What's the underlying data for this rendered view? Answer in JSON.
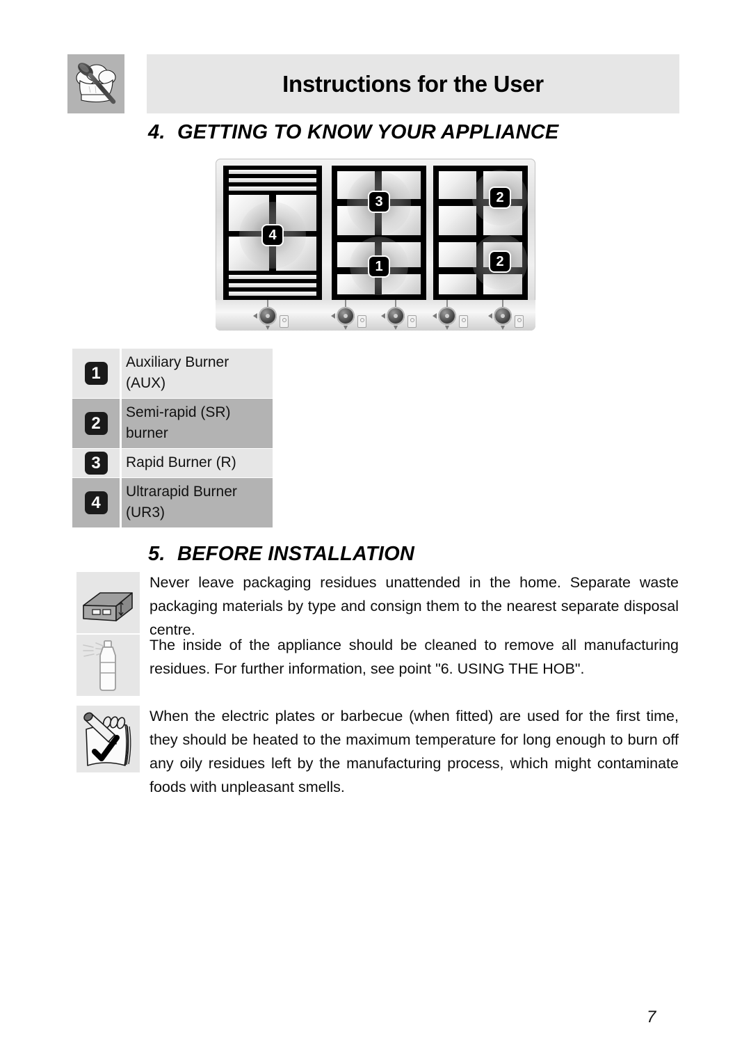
{
  "header": {
    "logo_icon": "chef-hat-spoon-icon",
    "title": "Instructions for the User"
  },
  "sections": [
    {
      "number": "4.",
      "title": "GETTING TO KNOW YOUR APPLIANCE"
    },
    {
      "number": "5.",
      "title": "BEFORE INSTALLATION"
    }
  ],
  "hob": {
    "alt": "Five-burner gas hob with three grate panels and five control knobs",
    "burner_markers": [
      {
        "label": "4",
        "panel": "left",
        "position": "centre"
      },
      {
        "label": "3",
        "panel": "middle",
        "position": "top"
      },
      {
        "label": "1",
        "panel": "middle",
        "position": "bottom"
      },
      {
        "label": "2",
        "panel": "right",
        "position": "top"
      },
      {
        "label": "2",
        "panel": "right",
        "position": "bottom"
      }
    ],
    "knob_count": 5
  },
  "legend": {
    "rows": [
      {
        "num": "1",
        "label": "Auxiliary Burner (AUX)",
        "shade": "light"
      },
      {
        "num": "2",
        "label": "Semi-rapid (SR) burner",
        "shade": "dark"
      },
      {
        "num": "3",
        "label": "Rapid Burner (R)",
        "shade": "light"
      },
      {
        "num": "4",
        "label": "Ultrarapid Burner (UR3)",
        "shade": "dark"
      }
    ]
  },
  "paragraphs": [
    {
      "icon": "cardboard-box-icon",
      "text": "Never leave packaging residues unattended in the home. Separate waste packaging materials by type and consign them to the nearest separate disposal centre."
    },
    {
      "icon": "spray-bottle-icon",
      "text": "The inside of the appliance should be cleaned to remove all manufacturing residues. For further information, see point \"6. USING THE HOB\"."
    },
    {
      "icon": "notepad-pencil-check-icon",
      "text": "When the electric plates or barbecue (when fitted) are used for the first time, they should be heated to the maximum temperature for long enough to burn off any oily residues left by the manufacturing process, which might contaminate foods with unpleasant smells."
    }
  ],
  "footer": {
    "page_number": "7"
  },
  "colors": {
    "header_bar": "#e6e6e6",
    "logo_bg": "#b3b3b3",
    "legend_light": "#e6e6e6",
    "legend_dark": "#b3b3b3",
    "badge_bg": "#1a1a1a",
    "text": "#000000"
  }
}
